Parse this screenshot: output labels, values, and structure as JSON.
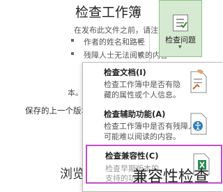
{
  "document": {
    "title": "检查工作簿",
    "lines": [
      "在发布此文件之前，请注意其包含以",
      "作者的姓名和路径",
      "残障人士无法阅读的内容"
    ],
    "mid_text": "本。",
    "mid_text2": "保存的上一个版本。",
    "bottom_text": "浏览项"
  },
  "ribbon": {
    "check_issues_label": "检查问题",
    "dropdown_arrow": "▾"
  },
  "menu": {
    "items": [
      {
        "title": "检查文档(I)",
        "desc_lines": [
          "检查工作簿中是否有隐",
          "藏的属性或个人信息。"
        ]
      },
      {
        "title": "检查辅助功能(A)",
        "desc_lines": [
          "检查工作簿中是否有残障人士",
          "可能难以阅读的内容。"
        ]
      },
      {
        "title": "检查兼容性(C)",
        "desc_lines": [
          "检查早期版本的",
          "支持的功能。"
        ]
      }
    ]
  },
  "watermark": "兼容性检查"
}
